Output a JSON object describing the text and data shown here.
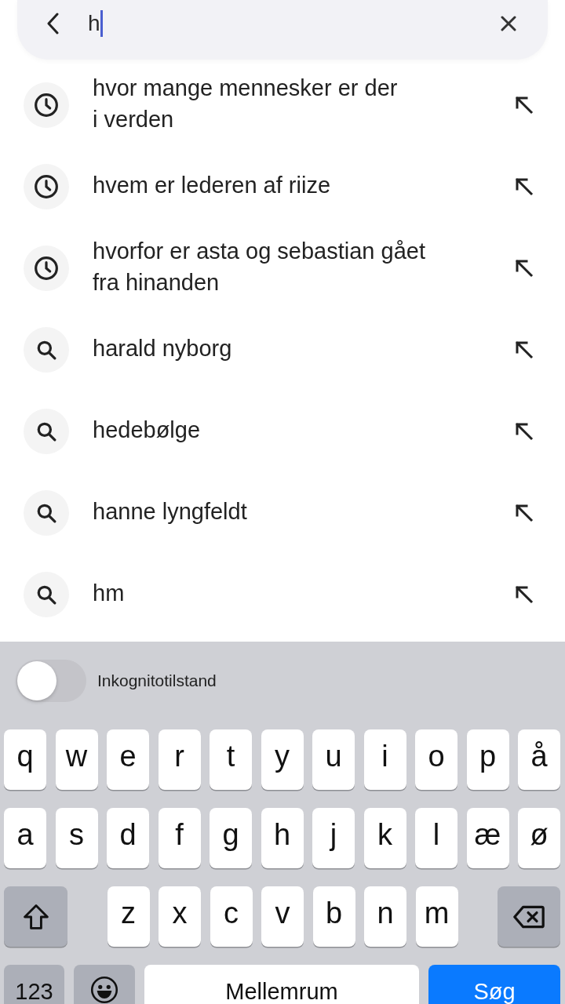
{
  "search": {
    "value": "h",
    "focused": true
  },
  "suggestions": [
    {
      "kind": "history",
      "text": "hvor mange mennesker er der\ni verden"
    },
    {
      "kind": "history",
      "text": "hvem er lederen af riize"
    },
    {
      "kind": "history",
      "text": "hvorfor er asta og sebastian gået\nfra hinanden"
    },
    {
      "kind": "query",
      "text": "harald nyborg"
    },
    {
      "kind": "query",
      "text": "hedebølge"
    },
    {
      "kind": "query",
      "text": "hanne lyngfeldt"
    },
    {
      "kind": "query",
      "text": "hm"
    }
  ],
  "incognito": {
    "label": "Inkognitotilstand",
    "on": false
  },
  "keyboard": {
    "top_row": [
      "q",
      "w",
      "e",
      "r",
      "t",
      "y",
      "u",
      "i",
      "o",
      "p",
      "å"
    ],
    "middle_row": [
      "a",
      "s",
      "d",
      "f",
      "g",
      "h",
      "j",
      "k",
      "l",
      "æ",
      "ø"
    ],
    "bottom_letters": [
      "z",
      "x",
      "c",
      "v",
      "b",
      "n",
      "m"
    ],
    "numbers_key": "123",
    "space_key": "Mellemrum",
    "action_key": "Søg"
  }
}
